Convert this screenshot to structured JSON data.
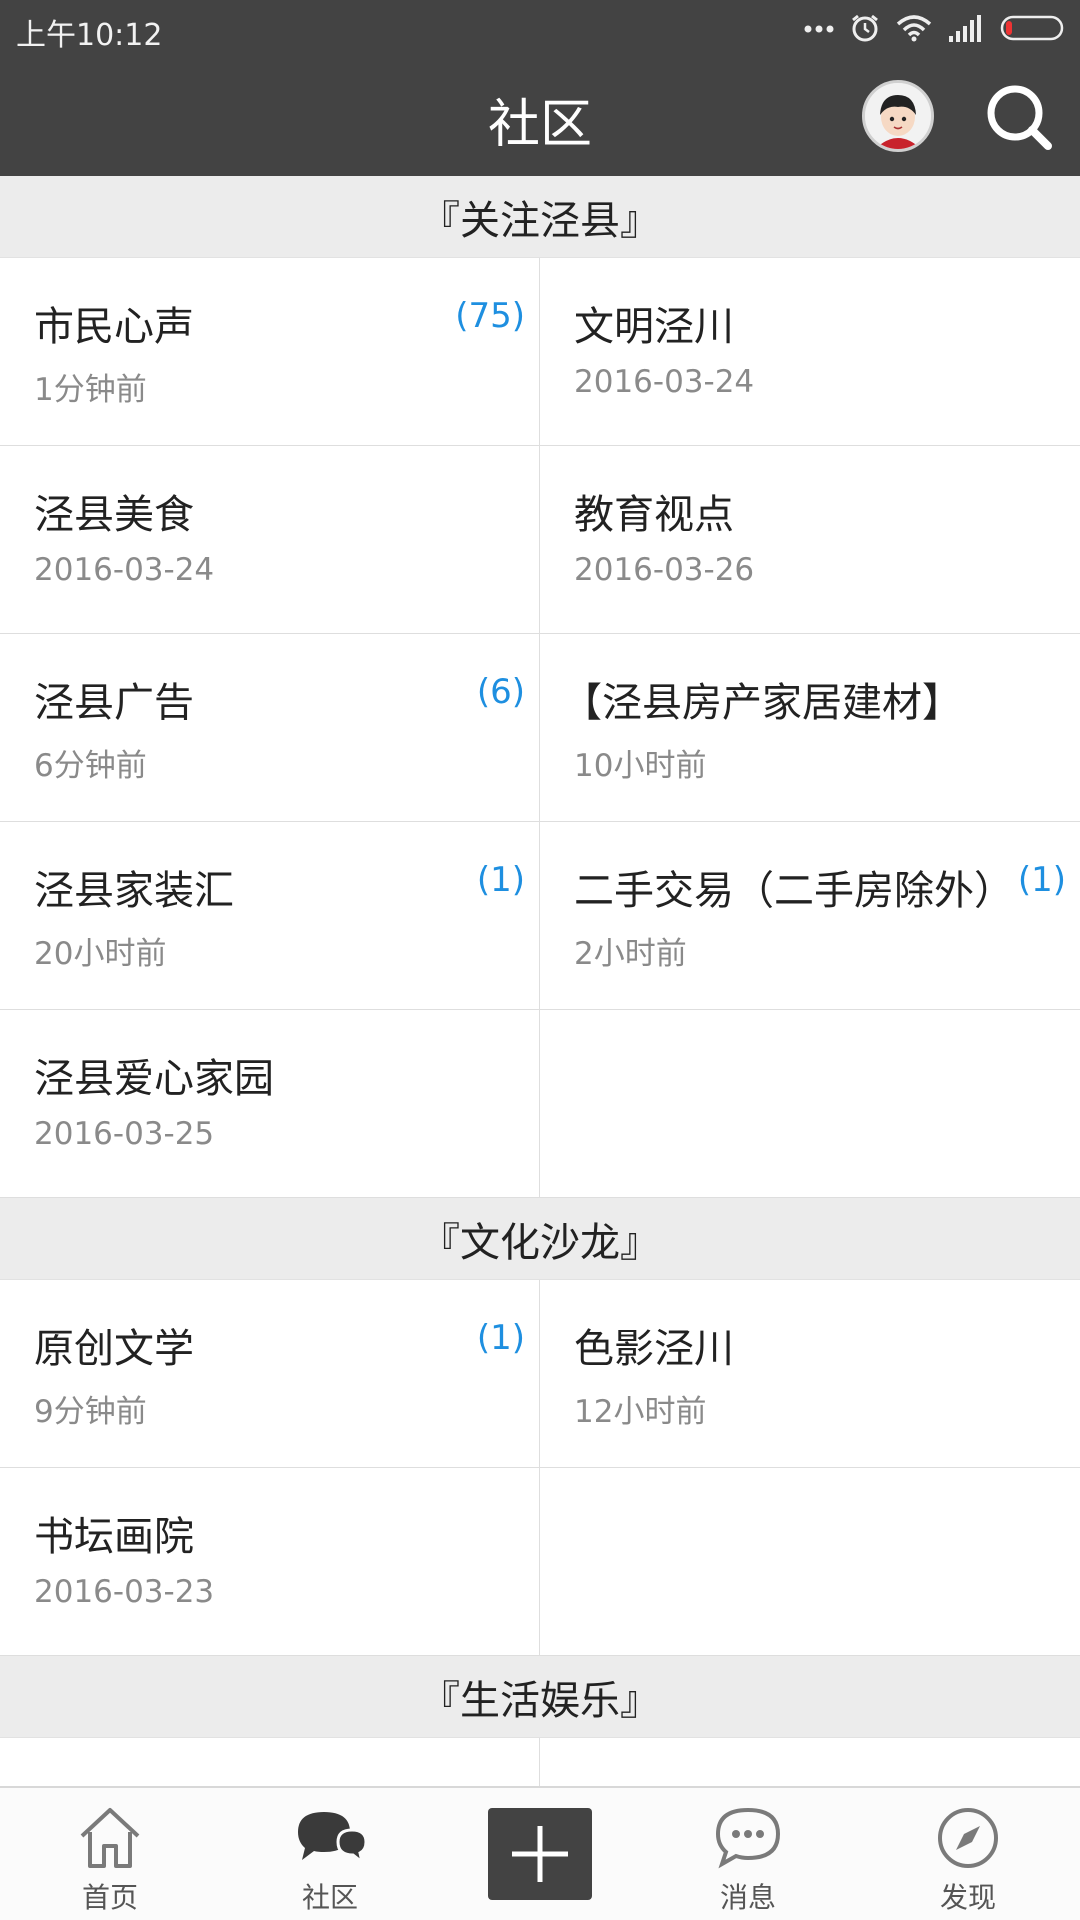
{
  "status": {
    "time": "上午10:12"
  },
  "header": {
    "title": "社区"
  },
  "sections": [
    {
      "title": "『关注泾县』",
      "items": [
        {
          "name": "市民心声",
          "time": "1分钟前",
          "count": "(75)"
        },
        {
          "name": "文明泾川",
          "time": "2016-03-24",
          "count": ""
        },
        {
          "name": "泾县美食",
          "time": "2016-03-24",
          "count": ""
        },
        {
          "name": "教育视点",
          "time": "2016-03-26",
          "count": ""
        },
        {
          "name": "泾县广告",
          "time": "6分钟前",
          "count": "(6)"
        },
        {
          "name": "【泾县房产家居建材】",
          "time": "10小时前",
          "count": ""
        },
        {
          "name": "泾县家装汇",
          "time": "20小时前",
          "count": "(1)"
        },
        {
          "name": "二手交易（二手房除外）",
          "time": "2小时前",
          "count": "(1)"
        },
        {
          "name": "泾县爱心家园",
          "time": "2016-03-25",
          "count": ""
        }
      ]
    },
    {
      "title": "『文化沙龙』",
      "items": [
        {
          "name": "原创文学",
          "time": "9分钟前",
          "count": "(1)"
        },
        {
          "name": "色影泾川",
          "time": "12小时前",
          "count": ""
        },
        {
          "name": "书坛画院",
          "time": "2016-03-23",
          "count": ""
        }
      ]
    },
    {
      "title": "『生活娱乐』",
      "items": []
    }
  ],
  "bottom_nav": {
    "home": "首页",
    "community": "社区",
    "messages": "消息",
    "discover": "发现"
  },
  "colors": {
    "bar": "#434343",
    "accent": "#1e8fe0",
    "section_bg": "#ececec"
  },
  "icons": [
    "wifi-icon",
    "alarm-icon",
    "signal-icon",
    "battery-icon",
    "avatar",
    "search-icon",
    "home-icon",
    "community-icon",
    "add-icon",
    "message-icon",
    "compass-icon"
  ]
}
